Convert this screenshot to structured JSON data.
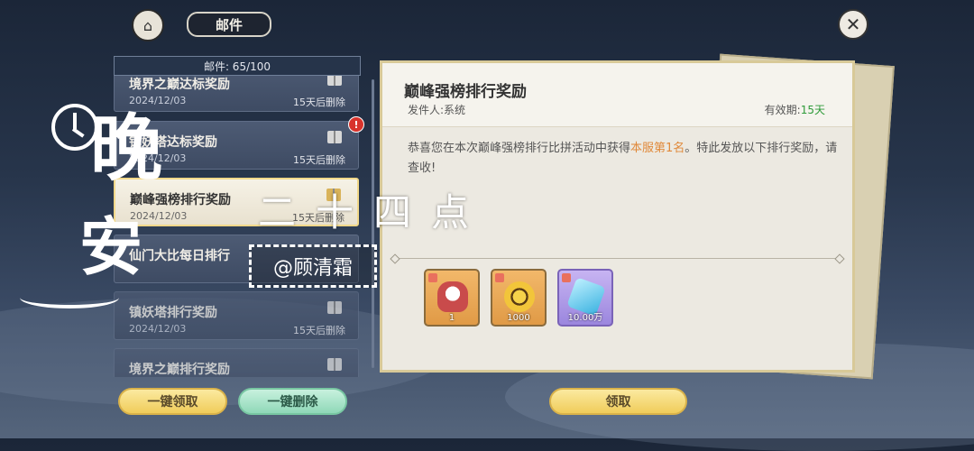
{
  "header": {
    "title": "邮件",
    "menu_icon": "pagoda-icon",
    "close_icon": "close-icon"
  },
  "mail_count": "邮件: 65/100",
  "mails": [
    {
      "title": "境界之巅达标奖励",
      "date": "2024/12/03",
      "expire": "15天后删除"
    },
    {
      "title": "镇妖塔达标奖励",
      "date": "2024/12/03",
      "expire": "15天后删除"
    },
    {
      "title": "巅峰强榜排行奖励",
      "date": "2024/12/03",
      "expire": "15天后删除"
    },
    {
      "title": "仙门大比每日排行",
      "date": "",
      "expire": ""
    },
    {
      "title": "镇妖塔排行奖励",
      "date": "2024/12/03",
      "expire": "15天后删除"
    },
    {
      "title": "境界之巅排行奖励",
      "date": "",
      "expire": ""
    }
  ],
  "badge": "!",
  "detail": {
    "title": "巅峰强榜排行奖励",
    "sender": "发件人:系统",
    "validity_label": "有效期:",
    "validity_days": "15天",
    "content_pre": "恭喜您在本次巅峰强榜排行比拼活动中获得",
    "content_highlight": "本服第1名",
    "content_post": "。特此发放以下排行奖励，请查收!",
    "rewards": [
      {
        "icon": "coat-icon",
        "qty": "1"
      },
      {
        "icon": "coin-icon",
        "qty": "1000"
      },
      {
        "icon": "gem-icon",
        "qty": "10.00万"
      }
    ]
  },
  "buttons": {
    "claim_all": "一键领取",
    "delete_all": "一键删除",
    "claim": "领取"
  },
  "overlay": {
    "char_wan": "晚",
    "char_an": "安",
    "time": "二十四点",
    "handle": "@顾清霜"
  },
  "colors": {
    "highlight": "#e0893a",
    "validity": "#2f9b3a",
    "badge": "#d8332c"
  }
}
